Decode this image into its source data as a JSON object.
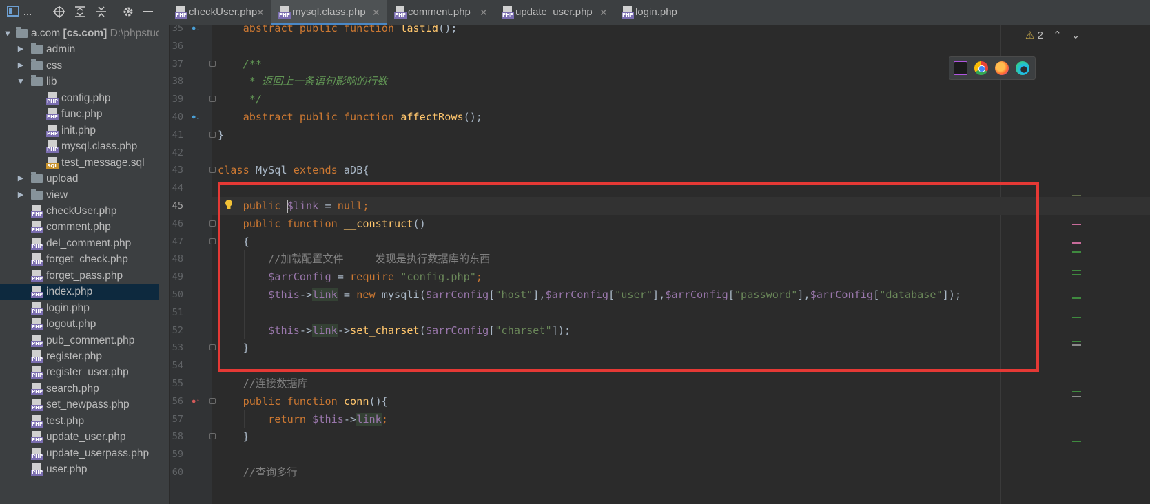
{
  "toolbar": {
    "project_label": "...",
    "icons": [
      "project-view-icon",
      "locate-icon",
      "expand-all-icon",
      "collapse-all-icon",
      "gear-icon",
      "minimize-icon"
    ]
  },
  "tabs": [
    {
      "label": "checkUser.php",
      "active": false
    },
    {
      "label": "mysql.class.php",
      "active": true
    },
    {
      "label": "comment.php",
      "active": false
    },
    {
      "label": "update_user.php",
      "active": false
    },
    {
      "label": "login.php",
      "active": false
    }
  ],
  "sidebar": {
    "root": {
      "name": "a.com",
      "module": "[cs.com]",
      "path": "D:\\phpstuc"
    },
    "items": [
      {
        "label": "admin",
        "type": "folder",
        "depth": 1,
        "expanded": false
      },
      {
        "label": "css",
        "type": "folder",
        "depth": 1,
        "expanded": false
      },
      {
        "label": "lib",
        "type": "folder",
        "depth": 1,
        "expanded": true
      },
      {
        "label": "config.php",
        "type": "php",
        "depth": 2
      },
      {
        "label": "func.php",
        "type": "php",
        "depth": 2
      },
      {
        "label": "init.php",
        "type": "php",
        "depth": 2
      },
      {
        "label": "mysql.class.php",
        "type": "php",
        "depth": 2
      },
      {
        "label": "test_message.sql",
        "type": "sql",
        "depth": 2
      },
      {
        "label": "upload",
        "type": "folder",
        "depth": 1,
        "expanded": false
      },
      {
        "label": "view",
        "type": "folder",
        "depth": 1,
        "expanded": false
      },
      {
        "label": "checkUser.php",
        "type": "php",
        "depth": 1
      },
      {
        "label": "comment.php",
        "type": "php",
        "depth": 1
      },
      {
        "label": "del_comment.php",
        "type": "php",
        "depth": 1
      },
      {
        "label": "forget_check.php",
        "type": "php",
        "depth": 1
      },
      {
        "label": "forget_pass.php",
        "type": "php",
        "depth": 1
      },
      {
        "label": "index.php",
        "type": "php",
        "depth": 1,
        "selected": true
      },
      {
        "label": "login.php",
        "type": "php",
        "depth": 1
      },
      {
        "label": "logout.php",
        "type": "php",
        "depth": 1
      },
      {
        "label": "pub_comment.php",
        "type": "php",
        "depth": 1
      },
      {
        "label": "register.php",
        "type": "php",
        "depth": 1
      },
      {
        "label": "register_user.php",
        "type": "php",
        "depth": 1
      },
      {
        "label": "search.php",
        "type": "php",
        "depth": 1
      },
      {
        "label": "set_newpass.php",
        "type": "php",
        "depth": 1
      },
      {
        "label": "test.php",
        "type": "php",
        "depth": 1
      },
      {
        "label": "update_user.php",
        "type": "php",
        "depth": 1
      },
      {
        "label": "update_userpass.php",
        "type": "php",
        "depth": 1
      },
      {
        "label": "user.php",
        "type": "php",
        "depth": 1
      }
    ]
  },
  "editor": {
    "current_line": 45,
    "warnings": "2",
    "line_numbers": [
      "35",
      "36",
      "37",
      "38",
      "39",
      "40",
      "41",
      "42",
      "43",
      "44",
      "45",
      "46",
      "47",
      "48",
      "49",
      "50",
      "51",
      "52",
      "53",
      "54",
      "55",
      "56",
      "57",
      "58",
      "59",
      "60"
    ],
    "lines": {
      "l35": [
        "abstract ",
        "public ",
        "function ",
        "lastId",
        "();"
      ],
      "l37": "/**",
      "l38": " * 返回上一条语句影响的行数",
      "l39": " */",
      "l40": [
        "abstract ",
        "public ",
        "function ",
        "affectRows",
        "();"
      ],
      "l41": "}",
      "l43": [
        "class ",
        "MySql ",
        "extends ",
        "aDB{"
      ],
      "l45": [
        "public ",
        "$link",
        " = ",
        "null",
        ";"
      ],
      "l46": [
        "public ",
        "function ",
        "__construct",
        "()"
      ],
      "l47": "{",
      "l48": "//加载配置文件     发现是执行数据库的东西",
      "l49": [
        "$arrConfig",
        " = ",
        "require ",
        "\"config.php\"",
        ";"
      ],
      "l50": [
        "$this",
        "->",
        "link",
        " = ",
        "new ",
        "mysqli(",
        "$arrConfig",
        "[",
        "\"host\"",
        "],",
        "$arrConfig",
        "[",
        "\"user\"",
        "],",
        "$arrConfig",
        "[",
        "\"password\"",
        "],",
        "$arrConfig",
        "[",
        "\"database\"",
        "]);"
      ],
      "l52": [
        "$this",
        "->",
        "link",
        "->",
        "set_charset",
        "(",
        "$arrConfig",
        "[",
        "\"charset\"",
        "]);"
      ],
      "l53": "}",
      "l55": "//连接数据库",
      "l56": [
        "public ",
        "function ",
        "conn",
        "(){"
      ],
      "l57": [
        "return ",
        "$this",
        "->",
        "link",
        ";"
      ],
      "l58": "}",
      "l60": "//查询多行"
    }
  },
  "browsers": [
    "phpstorm-icon",
    "chrome-icon",
    "firefox-icon",
    "edge-icon"
  ],
  "colors": {
    "highlight_box": "#e53935",
    "keyword": "#cc7832",
    "variable": "#9876aa",
    "function": "#ffc66d",
    "string": "#6a8759",
    "comment": "#808080"
  }
}
